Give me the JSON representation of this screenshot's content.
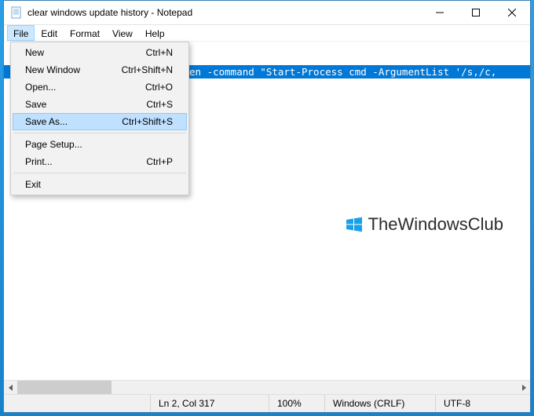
{
  "titlebar": {
    "title": "clear windows update history - Notepad"
  },
  "menubar": {
    "items": [
      "File",
      "Edit",
      "Format",
      "View",
      "Help"
    ],
    "open_index": 0
  },
  "dropdown": {
    "items": [
      {
        "label": "New",
        "shortcut": "Ctrl+N"
      },
      {
        "label": "New Window",
        "shortcut": "Ctrl+Shift+N"
      },
      {
        "label": "Open...",
        "shortcut": "Ctrl+O"
      },
      {
        "label": "Save",
        "shortcut": "Ctrl+S"
      },
      {
        "label": "Save As...",
        "shortcut": "Ctrl+Shift+S",
        "hover": true
      },
      {
        "sep": true
      },
      {
        "label": "Page Setup...",
        "shortcut": ""
      },
      {
        "label": "Print...",
        "shortcut": "Ctrl+P"
      },
      {
        "sep": true
      },
      {
        "label": "Exit",
        "shortcut": ""
      }
    ]
  },
  "content": {
    "visible_text": "en -command \"Start-Process cmd -ArgumentList '/s,/c,"
  },
  "watermark": {
    "text": "TheWindowsClub"
  },
  "statusbar": {
    "position": "Ln 2, Col 317",
    "zoom": "100%",
    "line_ending": "Windows (CRLF)",
    "encoding": "UTF-8"
  }
}
